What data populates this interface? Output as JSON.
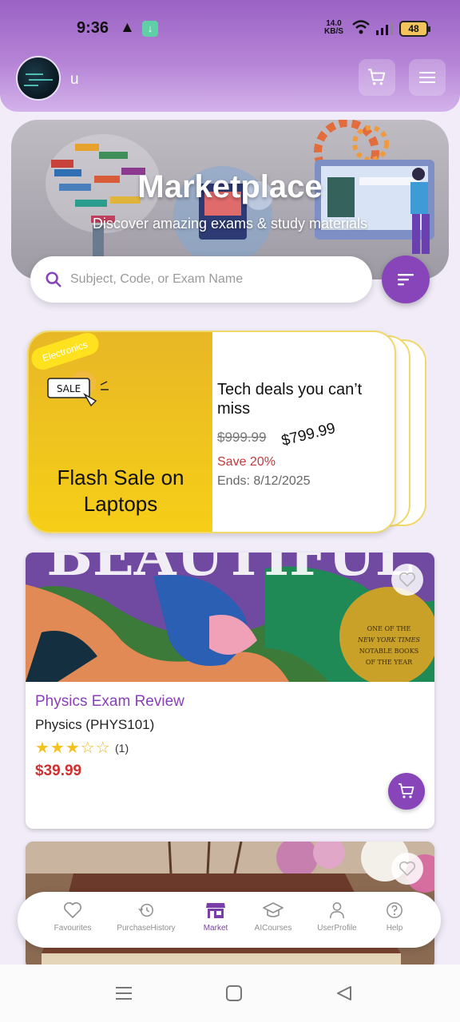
{
  "status_bar": {
    "time": "9:36",
    "net_speed_value": "14.0",
    "net_speed_unit": "KB/S",
    "battery": "48"
  },
  "header": {
    "username": "u",
    "cart_icon": "cart-icon",
    "menu_icon": "hamburger-menu-icon"
  },
  "hero": {
    "title": "Marketplace",
    "subtitle": "Discover amazing exams & study materials"
  },
  "search": {
    "placeholder": "Subject, Code, or Exam Name",
    "value": "",
    "icon": "search-icon",
    "filter_icon": "sort-filter-icon"
  },
  "deal": {
    "category": "Electronics",
    "badge_text": "SALE",
    "name": "Flash Sale on Laptops",
    "description": "Tech deals you can’t miss",
    "original_price": "$999.99",
    "sale_price": "$799.99",
    "discount": "Save 20%",
    "ends": "Ends: 8/12/2025"
  },
  "products": [
    {
      "cover_title": "BEAUTIFUL",
      "cover_seal": "ONE OF THE NEW YORK TIMES NOTABLE BOOKS OF THE YEAR",
      "title": "Physics Exam Review",
      "subject": "Physics (PHYS101)",
      "rating": 3,
      "rating_max": 5,
      "stars_filled": "★★★",
      "stars_empty": "☆☆",
      "rating_count": "(1)",
      "price": "$39.99"
    }
  ],
  "bottom_nav": {
    "items": [
      {
        "label": "Favourites",
        "icon": "heart-icon"
      },
      {
        "label": "PurchaseHistory",
        "icon": "history-icon"
      },
      {
        "label": "Market",
        "icon": "store-icon"
      },
      {
        "label": "AICourses",
        "icon": "graduation-cap-icon"
      },
      {
        "label": "UserProfile",
        "icon": "user-icon"
      },
      {
        "label": "Help",
        "icon": "help-icon"
      }
    ],
    "active": "Market"
  },
  "colors": {
    "accent": "#8845ba",
    "header": "#a66ccd",
    "price": "#d0302f",
    "deal_yellow": "#f6cf17",
    "star": "#f4c21d"
  }
}
